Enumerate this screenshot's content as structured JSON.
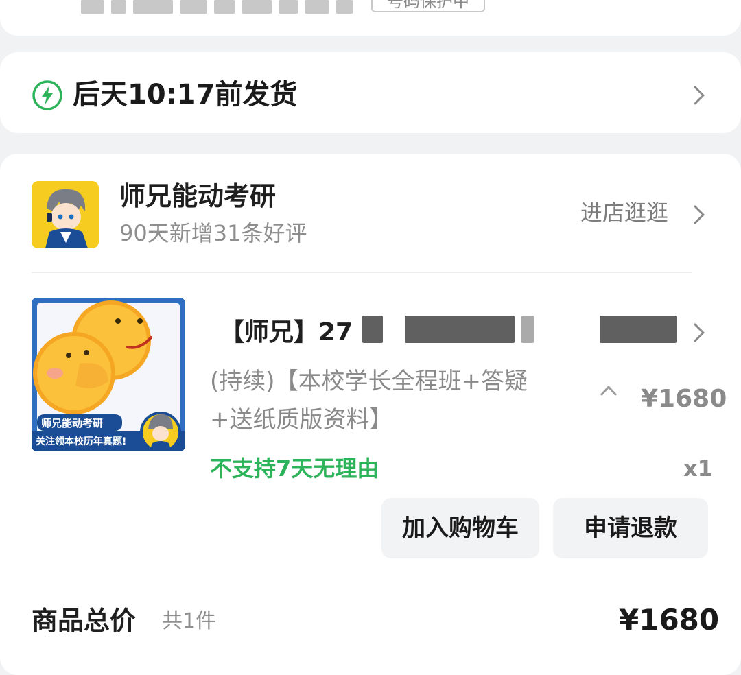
{
  "top": {
    "tag_text": "号码保护中"
  },
  "shipping": {
    "text": "后天10:17前发货",
    "icon": "lightning-bolt-icon"
  },
  "shop": {
    "name": "师兄能动考研",
    "subtitle": "90天新增31条好评",
    "visit_label": "进店逛逛"
  },
  "product": {
    "title_prefix": "【师兄】27",
    "spec_line1": "(持续)【本校学长全程班+答疑",
    "spec_line2": "+送纸质版资料】",
    "unit_price": "¥1680",
    "no_return": "不支持7天无理由",
    "quantity": "x1",
    "thumb_caption1": "师兄能动考研",
    "thumb_caption2": "关注领本校历年真题!"
  },
  "actions": {
    "add_to_cart": "加入购物车",
    "refund": "申请退款"
  },
  "summary": {
    "label": "商品总价",
    "count": "共1件",
    "total": "¥1680"
  },
  "colors": {
    "accent_green": "#2db45a",
    "background": "#f1f2f4"
  }
}
